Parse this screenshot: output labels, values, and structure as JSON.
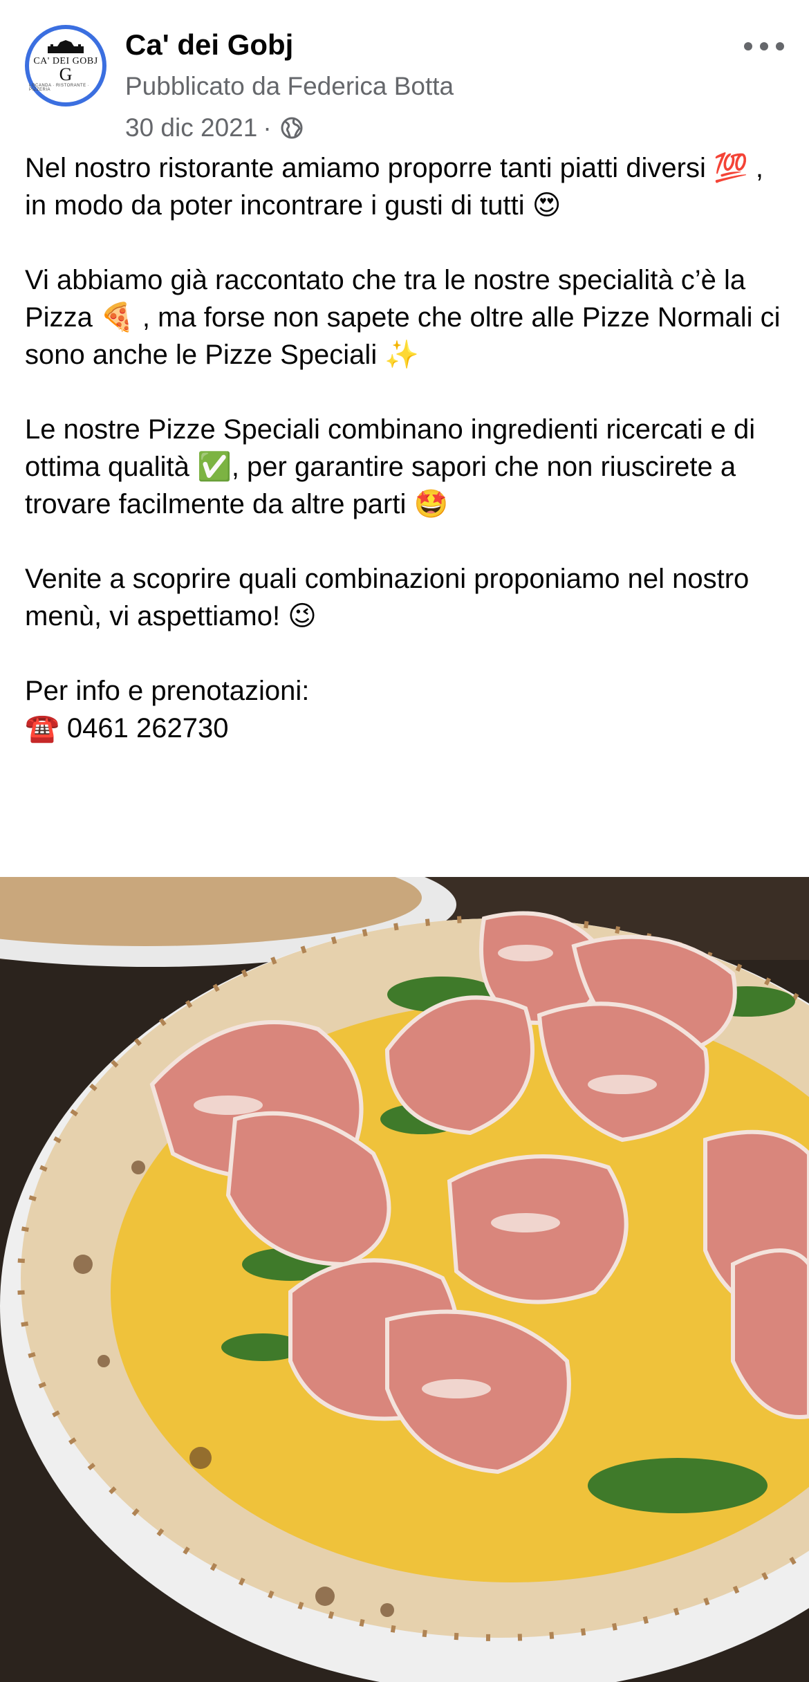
{
  "header": {
    "page_name": "Ca' dei Gobj",
    "publisher": "Pubblicato da Federica Botta",
    "date": "30 dic 2021",
    "separator": "·",
    "audience_icon": "globe-icon",
    "more_icon": "more-options-icon"
  },
  "avatar": {
    "logo_text": "CA' DEI GOBJ",
    "monogram": "G",
    "tagline": "LOCANDA · RISTORANTE · PIZZERIA"
  },
  "post": {
    "paragraphs": [
      "Nel nostro ristorante amiamo proporre tanti piatti diversi 💯 , in modo da poter incontrare i gusti di tutti 😍",
      "Vi abbiamo già raccontato che tra le nostre specialità c’è la Pizza 🍕 , ma forse non sapete che oltre alle Pizze Normali ci sono anche le Pizze Speciali ✨",
      "Le nostre Pizze Speciali combinano ingredienti ricercati e di ottima qualità ✅, per garantire sapori che non riuscirete a trovare facilmente da altre parti 🤩",
      "Venite a scoprire quali combinazioni proponiamo nel nostro menù, vi aspettiamo! 😉",
      "Per info e prenotazioni:",
      "☎️ 0461 262730"
    ]
  },
  "photo": {
    "subject": "pizza-photo",
    "colors": {
      "table": "#2b231d",
      "crust": "#e9d6b5",
      "cheese": "#f0c23a",
      "prosciutto": "#d9867c",
      "arugula": "#3f7a2a",
      "plate": "#f2f2f2"
    }
  }
}
